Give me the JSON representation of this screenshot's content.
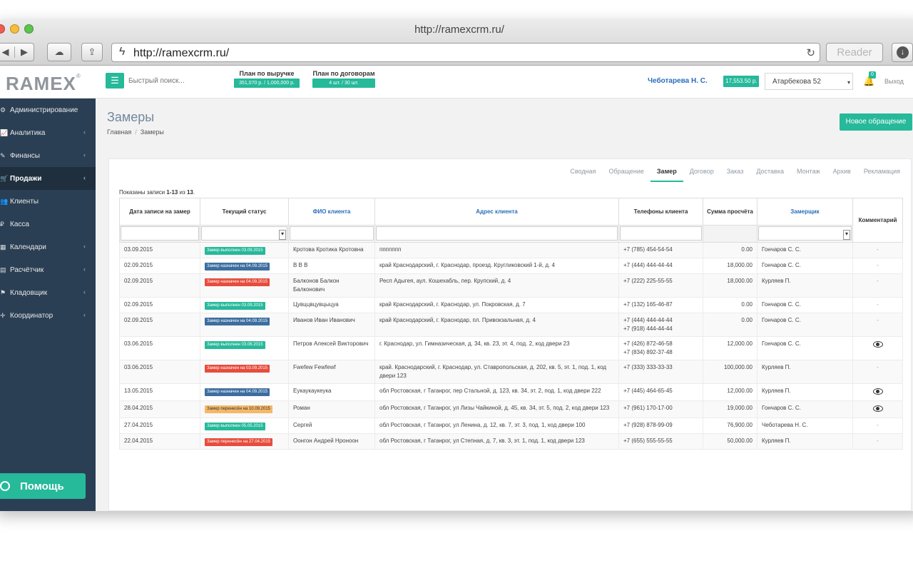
{
  "browser": {
    "window_title": "http://ramexcrm.ru/",
    "url": "http://ramexcrm.ru/",
    "reader_label": "Reader"
  },
  "topbar": {
    "logo": "RAMEX",
    "search_placeholder": "Быстрый поиск...",
    "plan_revenue_label": "План по выручке",
    "plan_revenue_value": "351,070 р. / 1,000,000 р.",
    "plan_revenue_progress": 0.35,
    "plan_contracts_label": "План по договорам",
    "plan_contracts_value": "4 шт. / 30 шт.",
    "user_name": "Чеботарева Н. С.",
    "balance": "17,553.50 р.",
    "branch": "Атарбекова 52",
    "notifications": "0",
    "logout": "Выход"
  },
  "sidebar": {
    "items": [
      {
        "label": "Администрирование",
        "icon": "gear-icon"
      },
      {
        "label": "Аналитика",
        "icon": "chart-icon"
      },
      {
        "label": "Финансы",
        "icon": "edit-icon"
      },
      {
        "label": "Продажи",
        "icon": "cart-icon"
      },
      {
        "label": "Клиенты",
        "icon": "users-icon"
      },
      {
        "label": "Касса",
        "icon": "ruble-icon"
      },
      {
        "label": "Календари",
        "icon": "calendar-icon"
      },
      {
        "label": "Расчётчик",
        "icon": "calculator-icon"
      },
      {
        "label": "Кладовщик",
        "icon": "warehouse-icon"
      },
      {
        "label": "Координатор",
        "icon": "crosshair-icon"
      }
    ],
    "help_label": "Помощь"
  },
  "page": {
    "title": "Замеры",
    "breadcrumb_home": "Главная",
    "breadcrumb_current": "Замеры",
    "new_button": "Новое обращение"
  },
  "tabs": [
    "Сводная",
    "Обращение",
    "Замер",
    "Договор",
    "Заказ",
    "Доставка",
    "Монтаж",
    "Архив",
    "Рекламация"
  ],
  "records": {
    "prefix": "Показаны записи ",
    "range": "1-13",
    "middle": " из ",
    "total": "13",
    "suffix": "."
  },
  "table": {
    "headers": [
      "Дата записи на замер",
      "Текущий статус",
      "ФИО клиента",
      "Адрес клиента",
      "Телефоны клиента",
      "Сумма просчёта",
      "Замерщик",
      "Комментарий"
    ],
    "rows": [
      {
        "date": "03.09.2015",
        "status": "Замер выполнен 03.09.2015",
        "status_color": "green",
        "client": "Кротова Кротика Кротовна",
        "address": "ппппппп",
        "phones": "+7 (785) 454-54-54",
        "sum": "0.00",
        "measurer": "Гончаров С. С.",
        "comment": "-"
      },
      {
        "date": "02.09.2015",
        "status": "Замер назначен на 04.09.2015",
        "status_color": "blue",
        "client": "В В В",
        "address": "край Краснодарский, г. Краснодар, проезд. Кругликовский 1-й, д. 4",
        "phones": "+7 (444) 444-44-44",
        "sum": "18,000.00",
        "measurer": "Гончаров С. С.",
        "comment": "-"
      },
      {
        "date": "02.09.2015",
        "status": "Замер назначен на 04.09.2015",
        "status_color": "red",
        "client": "Балконов Балкон Балконович",
        "address": "Респ Адыгея, аул. Кошехабль, пер. Крупский, д. 4",
        "phones": "+7 (222) 225-55-55",
        "sum": "18,000.00",
        "measurer": "Курляев П.",
        "comment": "-"
      },
      {
        "date": "02.09.2015",
        "status": "Замер выполнен 03.09.2015",
        "status_color": "green",
        "client": "Цувццвцувцыцуа",
        "address": "край Краснодарский, г. Краснодар, ул. Покровская, д. 7",
        "phones": "+7 (132) 165-46-87",
        "sum": "0.00",
        "measurer": "Гончаров С. С.",
        "comment": "-"
      },
      {
        "date": "02.09.2015",
        "status": "Замер назначен на 04.09.2015",
        "status_color": "blue",
        "client": "Иванов Иван Иванович",
        "address": "край Краснодарский, г. Краснодар, пл. Привокзальная, д. 4",
        "phones": "+7 (444) 444-44-44\n+7 (918) 444-44-44",
        "sum": "0.00",
        "measurer": "Гончаров С. С.",
        "comment": "-"
      },
      {
        "date": "03.06.2015",
        "status": "Замер выполнен 03.06.2015",
        "status_color": "green",
        "client": "Петров Алексей Викторович",
        "address": "г. Краснодар, ул. Гимназическая, д. 34, кв. 23, эт. 4, под. 2, код двери 23",
        "phones": "+7 (426) 872-46-58\n+7 (834) 892-37-48",
        "sum": "12,000.00",
        "measurer": "Гончаров С. С.",
        "comment": "eye"
      },
      {
        "date": "03.06.2015",
        "status": "Замер назначен на 03.09.2015",
        "status_color": "red",
        "client": "Fwefew Fewfewf",
        "address": "край. Краснодарский, г. Краснодар, ул. Ставропольская, д. 202, кв. 5, эт. 1, под. 1, код двери 123",
        "phones": "+7 (333) 333-33-33",
        "sum": "100,000.00",
        "measurer": "Курляев П.",
        "comment": "-"
      },
      {
        "date": "13.05.2015",
        "status": "Замер назначен на 04.09.2015",
        "status_color": "blue",
        "client": "Еукаукаукеука",
        "address": "обл Ростовская, г Таганрог, пер Стальной, д. 123, кв. 34, эт. 2, под. 1, код двери 222",
        "phones": "+7 (445) 464-65-45",
        "sum": "12,000.00",
        "measurer": "Курляев П.",
        "comment": "eye"
      },
      {
        "date": "28.04.2015",
        "status": "Замер перенесён на 10.09.2015",
        "status_color": "orange",
        "client": "Роман",
        "address": "обл Ростовская, г Таганрог, ул Лизы Чайкиной, д. 45, кв. 34, эт. 5, под. 2, код двери 123",
        "phones": "+7 (961) 170-17-00",
        "sum": "19,000.00",
        "measurer": "Гончаров С. С.",
        "comment": "eye"
      },
      {
        "date": "27.04.2015",
        "status": "Замер выполнен 05.05.2015",
        "status_color": "green",
        "client": "Сергей",
        "address": "обл Ростовская, г Таганрог, ул Ленина, д. 12, кв. 7, эт. 3, под. 1, код двери 100",
        "phones": "+7 (928) 878-99-09",
        "sum": "76,900.00",
        "measurer": "Чеботарева Н. С.",
        "comment": "-"
      },
      {
        "date": "22.04.2015",
        "status": "Замер перенесён на 27.04.2015",
        "status_color": "red",
        "client": "Оонгон Андрей Нроноон",
        "address": "обл Ростовская, г Таганрог, ул Степная, д. 7, кв. 3, эт. 1, под. 1, код двери 123",
        "phones": "+7 (655) 555-55-55",
        "sum": "50,000.00",
        "measurer": "Курляев П.",
        "comment": "-"
      }
    ]
  },
  "colors": {
    "accent": "#26b99a",
    "sidebar": "#2a3f54",
    "status_blue": "#3c6e9f",
    "status_red": "#e74c3c",
    "status_orange": "#f5b86a"
  }
}
